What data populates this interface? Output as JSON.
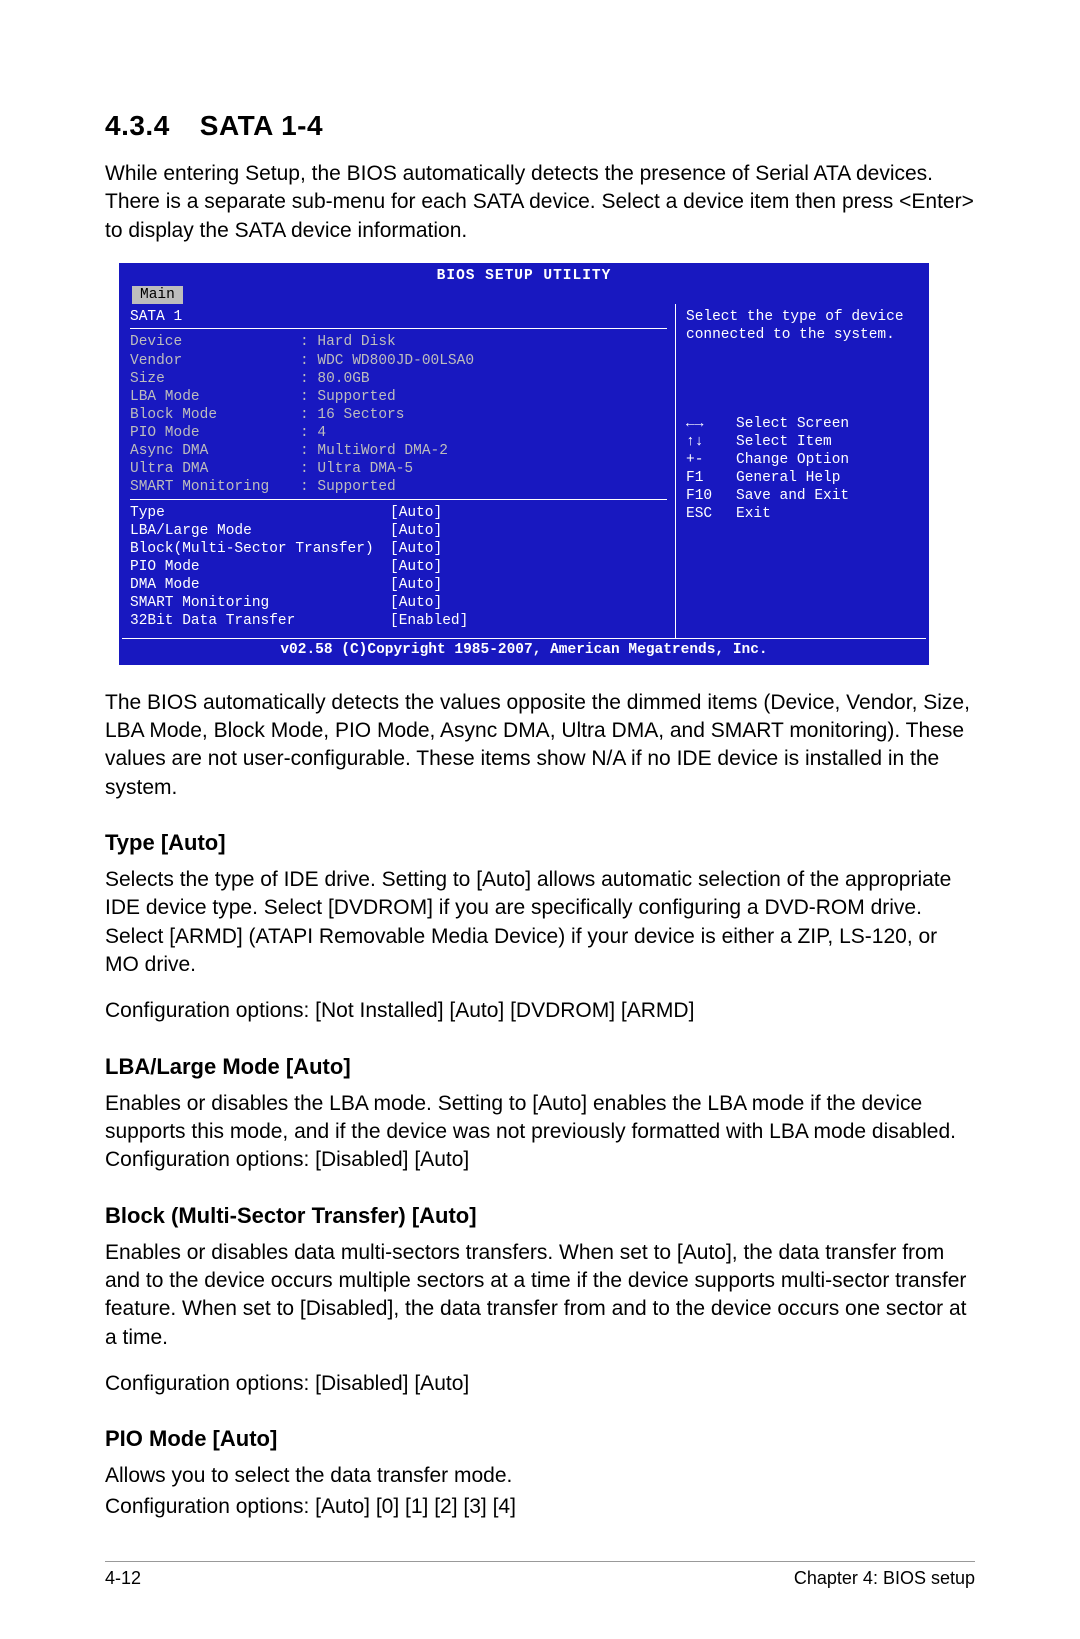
{
  "section": {
    "number": "4.3.4",
    "title": "SATA 1-4"
  },
  "intro": "While entering Setup, the BIOS automatically detects the presence of Serial ATA devices. There is a separate sub-menu for each SATA device. Select a device item then press <Enter> to display the SATA device information.",
  "bios": {
    "utility_title": "BIOS SETUP UTILITY",
    "tab": "Main",
    "panel_title": "SATA 1",
    "info": [
      {
        "label": "Device",
        "value": ": Hard Disk"
      },
      {
        "label": "Vendor",
        "value": ": WDC WD800JD-00LSA0"
      },
      {
        "label": "Size",
        "value": ": 80.0GB"
      },
      {
        "label": "LBA Mode",
        "value": ": Supported"
      },
      {
        "label": "Block Mode",
        "value": ": 16 Sectors"
      },
      {
        "label": "PIO Mode",
        "value": ": 4"
      },
      {
        "label": "Async DMA",
        "value": ": MultiWord DMA-2"
      },
      {
        "label": "Ultra DMA",
        "value": ": Ultra DMA-5"
      },
      {
        "label": "SMART Monitoring",
        "value": ": Supported"
      }
    ],
    "options": [
      {
        "label": "Type",
        "value": "[Auto]"
      },
      {
        "label": "LBA/Large Mode",
        "value": "[Auto]"
      },
      {
        "label": "Block(Multi-Sector Transfer)",
        "value": "[Auto]"
      },
      {
        "label": "PIO Mode",
        "value": "[Auto]"
      },
      {
        "label": "DMA Mode",
        "value": "[Auto]"
      },
      {
        "label": "SMART Monitoring",
        "value": "[Auto]"
      },
      {
        "label": "32Bit Data Transfer",
        "value": "[Enabled]"
      }
    ],
    "help": "Select the type of device connected to the system.",
    "nav": [
      {
        "key": "←→",
        "desc": "Select Screen"
      },
      {
        "key": "↑↓",
        "desc": "Select Item"
      },
      {
        "key": "+-",
        "desc": "Change Option"
      },
      {
        "key": "F1",
        "desc": "General Help"
      },
      {
        "key": "F10",
        "desc": "Save and Exit"
      },
      {
        "key": "ESC",
        "desc": "Exit"
      }
    ],
    "footer": "v02.58 (C)Copyright 1985-2007, American Megatrends, Inc."
  },
  "after_bios": "The BIOS automatically detects the values opposite the dimmed items (Device, Vendor, Size, LBA Mode, Block Mode, PIO Mode, Async DMA, Ultra DMA, and SMART monitoring). These values are not user-configurable. These items show N/A if no IDE device is installed in the system.",
  "subs": {
    "type": {
      "heading": "Type [Auto]",
      "p1": "Selects the type of IDE drive. Setting to [Auto] allows automatic selection of the appropriate IDE device type. Select [DVDROM] if you are specifically configuring a DVD-ROM drive. Select [ARMD] (ATAPI Removable Media Device) if your device is either a ZIP, LS-120, or MO drive.",
      "p2": "Configuration options: [Not Installed] [Auto] [DVDROM] [ARMD]"
    },
    "lba": {
      "heading": "LBA/Large Mode [Auto]",
      "p1": "Enables or disables the LBA mode. Setting to [Auto] enables the LBA mode if the device supports this mode, and if the device was not previously formatted with LBA mode disabled. Configuration options: [Disabled] [Auto]"
    },
    "block": {
      "heading": "Block (Multi-Sector Transfer) [Auto]",
      "p1": "Enables or disables data multi-sectors transfers. When set to [Auto], the data transfer from and to the device occurs multiple sectors at a time if the device supports multi-sector transfer feature. When set to [Disabled], the data transfer from and to the device occurs one sector at a time.",
      "p2": "Configuration options: [Disabled] [Auto]"
    },
    "pio": {
      "heading": "PIO Mode [Auto]",
      "p1": "Allows you to select the data transfer mode.",
      "p2": "Configuration options: [Auto] [0] [1] [2] [3] [4]"
    }
  },
  "footer": {
    "left": "4-12",
    "right": "Chapter 4: BIOS setup"
  }
}
